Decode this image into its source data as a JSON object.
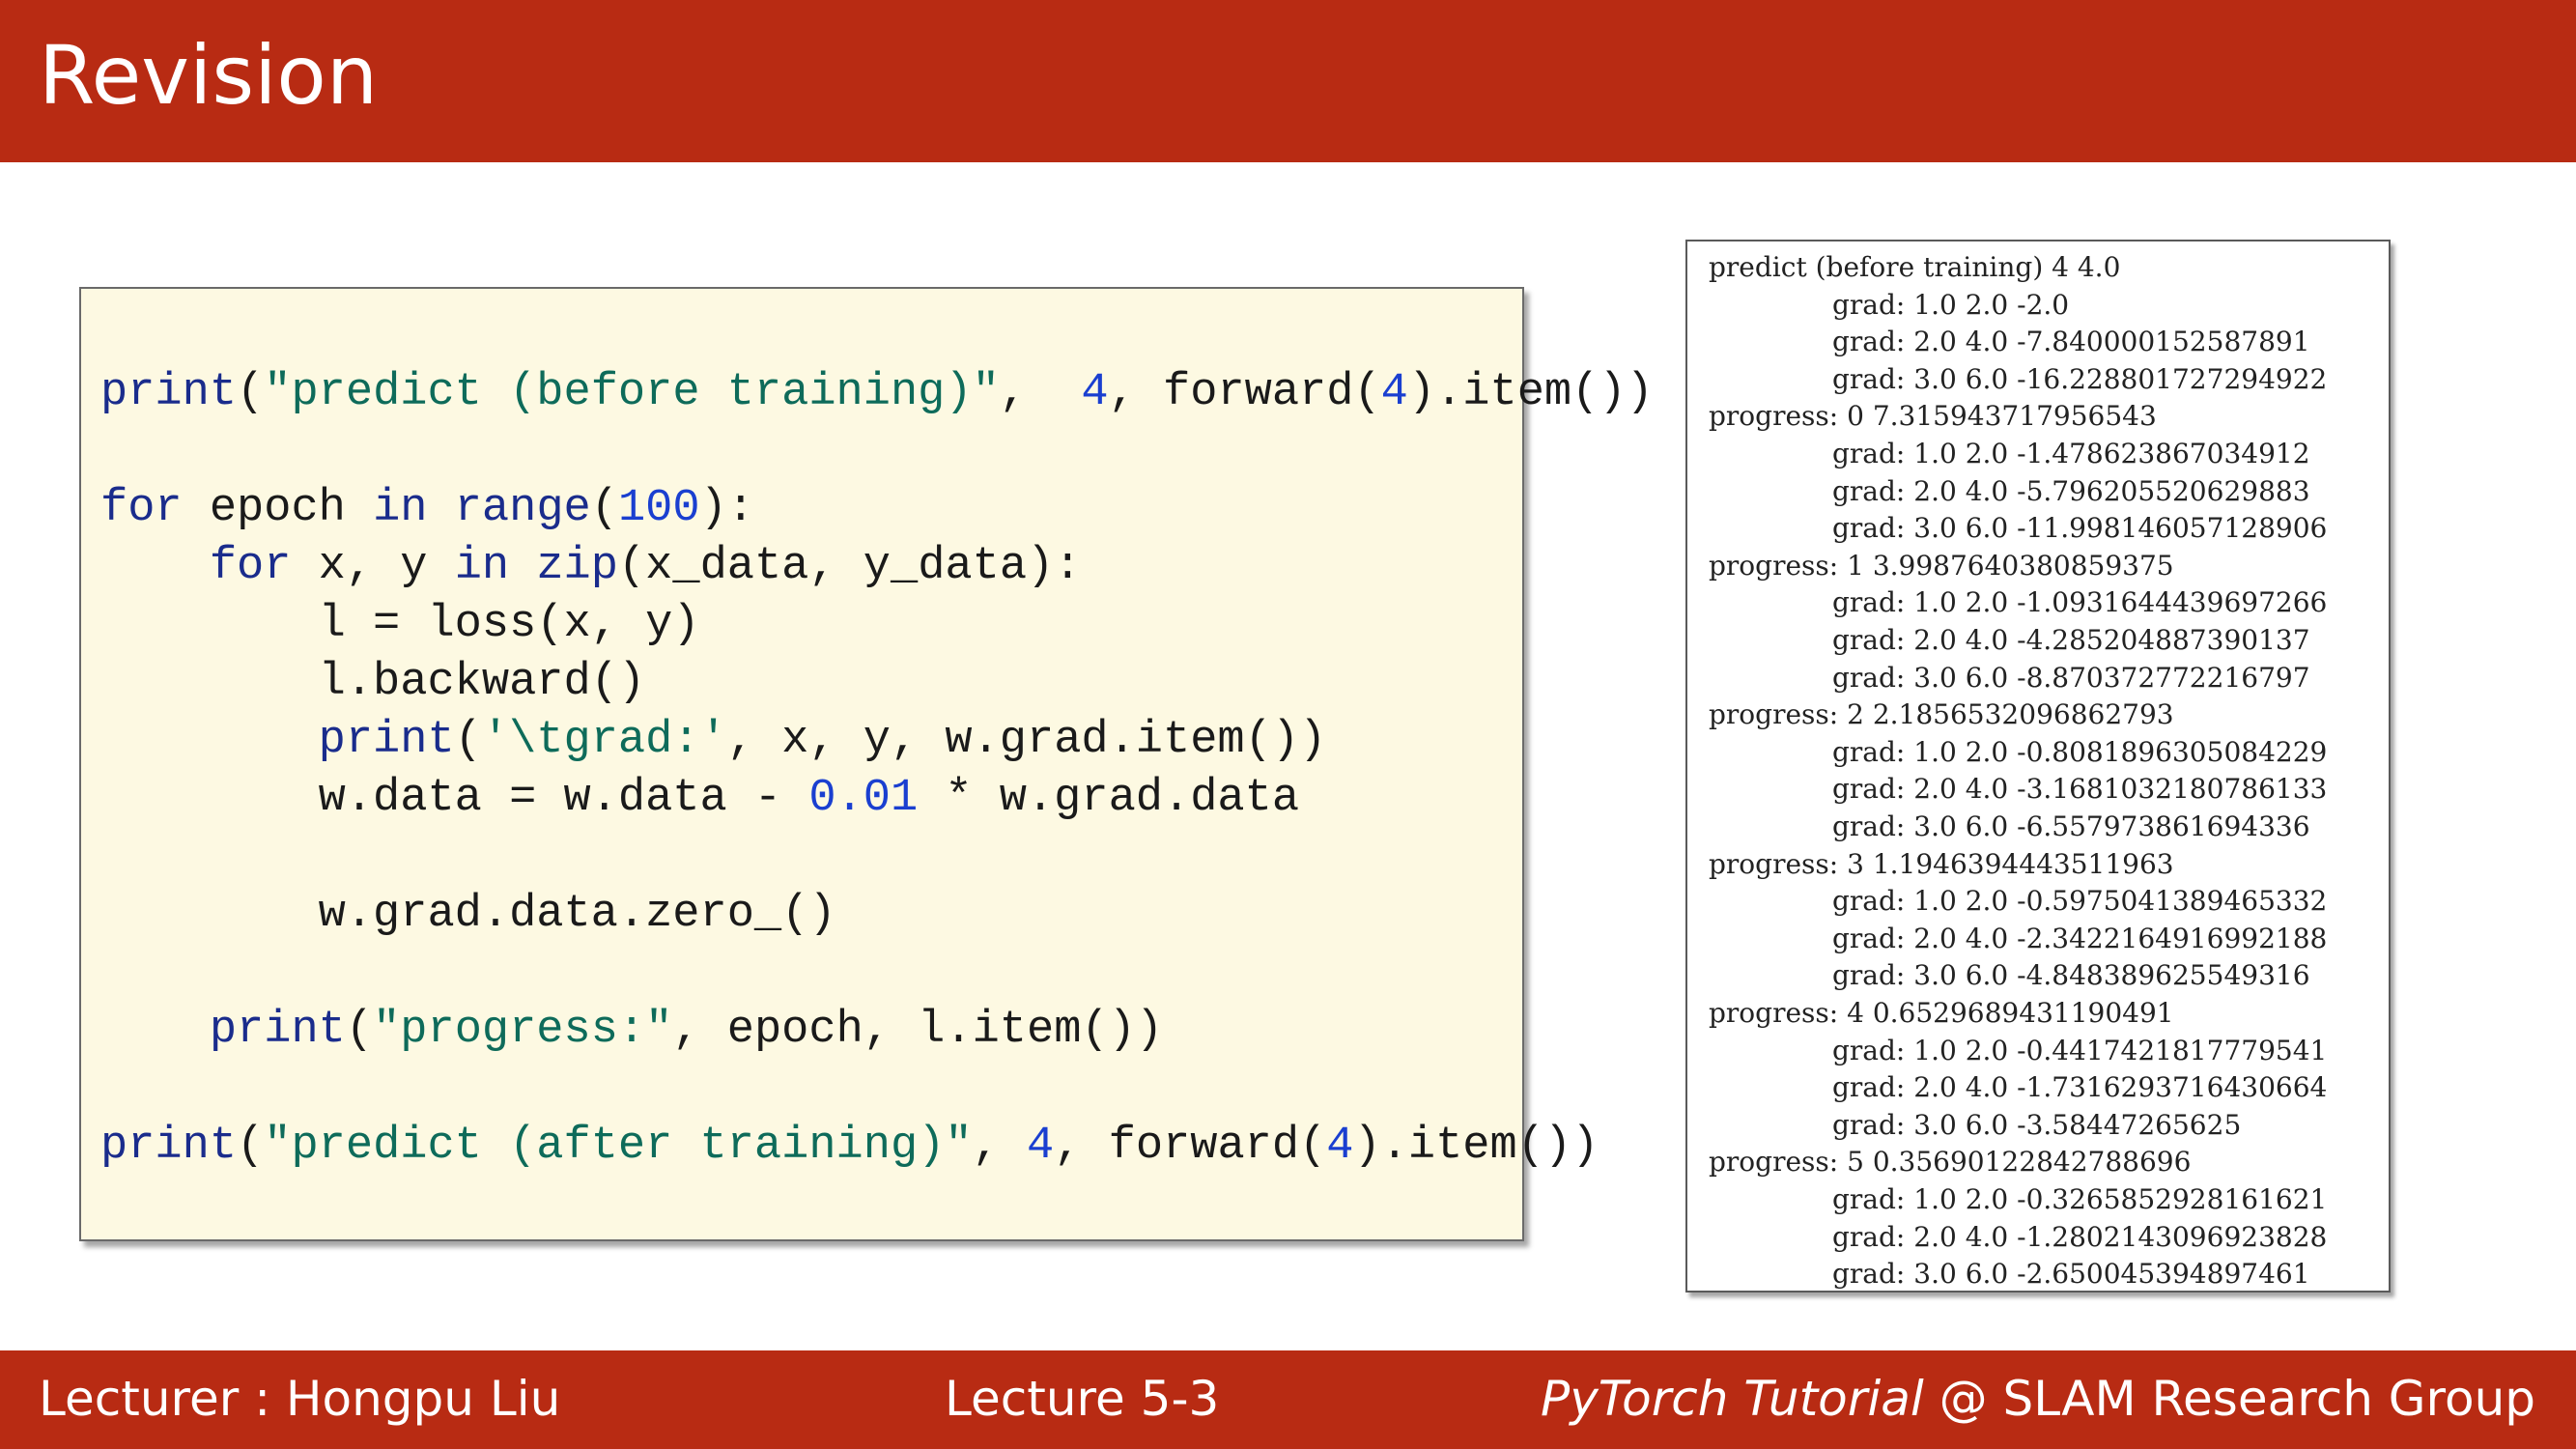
{
  "header": {
    "title": "Revision",
    "color": "#b82b13"
  },
  "code": {
    "lines": [
      "print(\"predict (before training)\",  4, forward(4).item())",
      "",
      "for epoch in range(100):",
      "    for x, y in zip(x_data, y_data):",
      "        l = loss(x, y)",
      "        l.backward()",
      "        print('\\tgrad:', x, y, w.grad.item())",
      "        w.data = w.data - 0.01 * w.grad.data",
      "",
      "        w.grad.data.zero_()",
      "",
      "    print(\"progress:\", epoch, l.item())",
      "",
      "print(\"predict (after training)\", 4, forward(4).item())"
    ],
    "background": "#fdf9e2"
  },
  "output": {
    "lines": [
      "predict (before training) 4 4.0",
      "\tgrad: 1.0 2.0 -2.0",
      "\tgrad: 2.0 4.0 -7.840000152587891",
      "\tgrad: 3.0 6.0 -16.228801727294922",
      "progress: 0 7.315943717956543",
      "\tgrad: 1.0 2.0 -1.478623867034912",
      "\tgrad: 2.0 4.0 -5.796205520629883",
      "\tgrad: 3.0 6.0 -11.998146057128906",
      "progress: 1 3.9987640380859375",
      "\tgrad: 1.0 2.0 -1.0931644439697266",
      "\tgrad: 2.0 4.0 -4.285204887390137",
      "\tgrad: 3.0 6.0 -8.870372772216797",
      "progress: 2 2.1856532096862793",
      "\tgrad: 1.0 2.0 -0.8081896305084229",
      "\tgrad: 2.0 4.0 -3.1681032180786133",
      "\tgrad: 3.0 6.0 -6.557973861694336",
      "progress: 3 1.1946394443511963",
      "\tgrad: 1.0 2.0 -0.5975041389465332",
      "\tgrad: 2.0 4.0 -2.3422164916992188",
      "\tgrad: 3.0 6.0 -4.848389625549316",
      "progress: 4 0.6529689431190491",
      "\tgrad: 1.0 2.0 -0.4417421817779541",
      "\tgrad: 2.0 4.0 -1.7316293716430664",
      "\tgrad: 3.0 6.0 -3.58447265625",
      "progress: 5 0.35690122842788696",
      "\tgrad: 1.0 2.0 -0.3265852928161621",
      "\tgrad: 2.0 4.0 -1.2802143096923828",
      "\tgrad: 3.0 6.0 -2.650045394897461"
    ]
  },
  "footer": {
    "lecturer": "Lecturer : Hongpu Liu",
    "lecture": "Lecture 5-3",
    "course_italic": "PyTorch Tutorial",
    "course_rest": " @ SLAM Research Group"
  }
}
